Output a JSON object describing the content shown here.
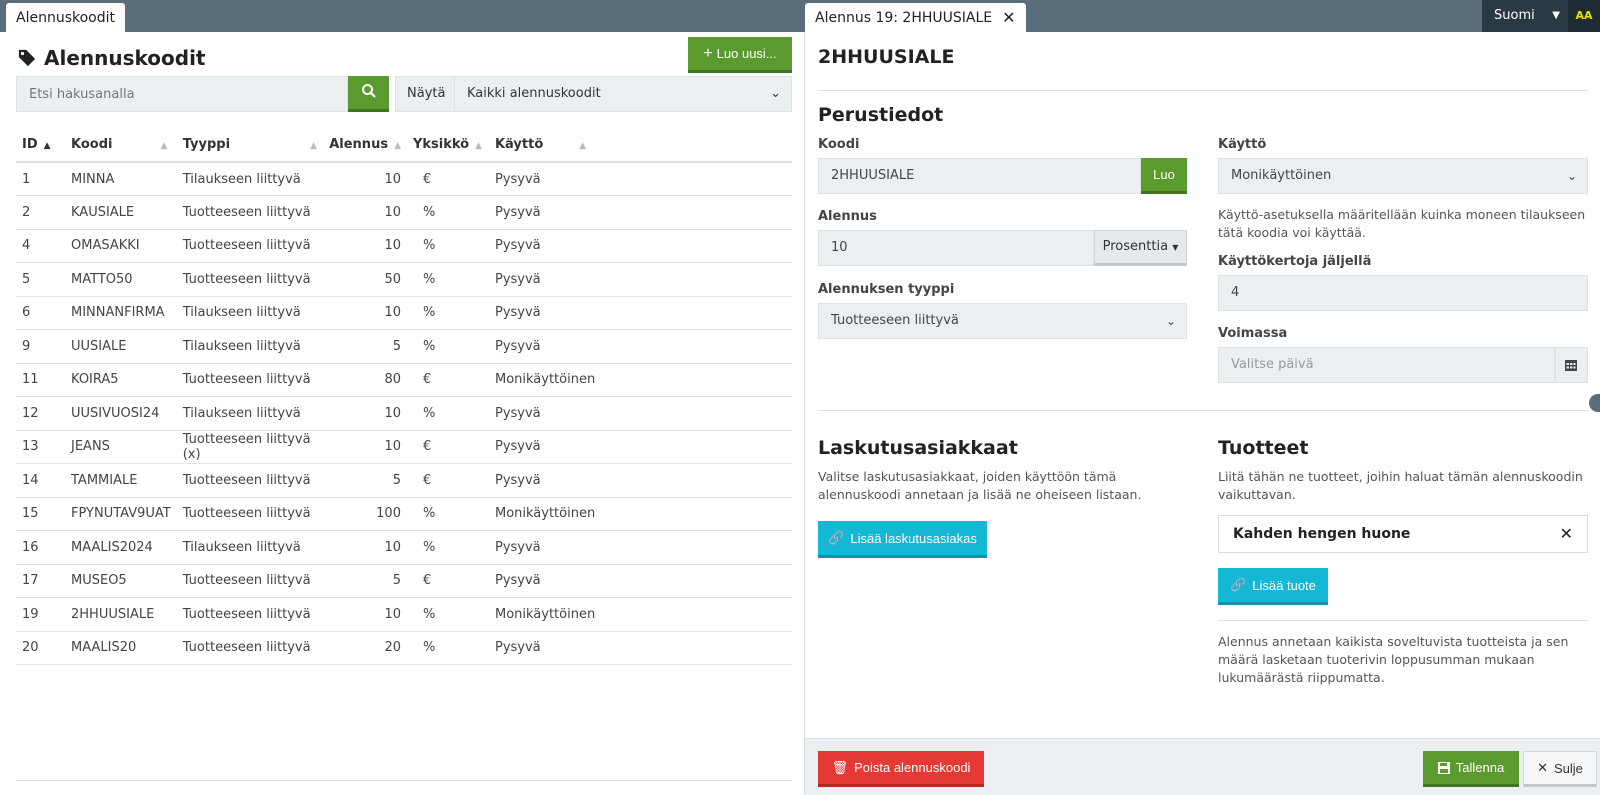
{
  "tabs": {
    "left_label": "Alennuskoodit",
    "right_label": "Alennus 19: 2HHUUSIALE"
  },
  "language": "Suomi",
  "accessibility_label": "AA",
  "list": {
    "title": "Alennuskoodit",
    "new_button": "Luo uusi...",
    "search_placeholder": "Etsi hakusanalla",
    "show_label": "Näytä",
    "show_value": "Kaikki alennuskoodit",
    "columns": [
      "ID",
      "Koodi",
      "Tyyppi",
      "Alennus",
      "Yksikkö",
      "Käyttö"
    ],
    "rows": [
      [
        "1",
        "MINNA",
        "Tilaukseen liittyvä",
        "10",
        "€",
        "Pysyvä"
      ],
      [
        "2",
        "KAUSIALE",
        "Tuotteeseen liittyvä",
        "10",
        "%",
        "Pysyvä"
      ],
      [
        "4",
        "OMASAKKI",
        "Tuotteeseen liittyvä",
        "10",
        "%",
        "Pysyvä"
      ],
      [
        "5",
        "MATTO50",
        "Tuotteeseen liittyvä",
        "50",
        "%",
        "Pysyvä"
      ],
      [
        "6",
        "MINNANFIRMA",
        "Tilaukseen liittyvä",
        "10",
        "%",
        "Pysyvä"
      ],
      [
        "9",
        "UUSIALE",
        "Tilaukseen liittyvä",
        "5",
        "%",
        "Pysyvä"
      ],
      [
        "11",
        "KOIRA5",
        "Tuotteeseen liittyvä",
        "80",
        "€",
        "Monikäyttöinen"
      ],
      [
        "12",
        "UUSIVUOSI24",
        "Tilaukseen liittyvä",
        "10",
        "%",
        "Pysyvä"
      ],
      [
        "13",
        "JEANS",
        "Tuotteeseen liittyvä (x)",
        "10",
        "€",
        "Pysyvä"
      ],
      [
        "14",
        "TAMMIALE",
        "Tuotteeseen liittyvä",
        "5",
        "€",
        "Pysyvä"
      ],
      [
        "15",
        "FPYNUTAV9UAT",
        "Tuotteeseen liittyvä",
        "100",
        "%",
        "Monikäyttöinen"
      ],
      [
        "16",
        "MAALIS2024",
        "Tilaukseen liittyvä",
        "10",
        "%",
        "Pysyvä"
      ],
      [
        "17",
        "MUSEO5",
        "Tuotteeseen liittyvä",
        "5",
        "€",
        "Pysyvä"
      ],
      [
        "19",
        "2HHUUSIALE",
        "Tuotteeseen liittyvä",
        "10",
        "%",
        "Monikäyttöinen"
      ],
      [
        "20",
        "MAALIS20",
        "Tuotteeseen liittyvä",
        "20",
        "%",
        "Pysyvä"
      ]
    ]
  },
  "detail": {
    "title": "2HHUUSIALE",
    "basic_title": "Perustiedot",
    "code_label": "Koodi",
    "code_value": "2HHUUSIALE",
    "generate_button": "Luo",
    "discount_label": "Alennus",
    "discount_value": "10",
    "unit_button": "Prosenttia",
    "type_label": "Alennuksen tyyppi",
    "type_value": "Tuotteeseen liittyvä",
    "usage_label": "Käyttö",
    "usage_value": "Monikäyttöinen",
    "usage_help": "Käyttö-asetuksella määritellään kuinka moneen tilaukseen tätä koodia voi käyttää.",
    "remaining_label": "Käyttökertoja jäljellä",
    "remaining_value": "4",
    "valid_label": "Voimassa",
    "valid_placeholder": "Valitse päivä",
    "customers_title": "Laskutusasiakkaat",
    "customers_help": "Valitse laskutusasiakkaat, joiden käyttöön tämä alennuskoodi annetaan ja lisää ne oheiseen listaan.",
    "add_customer_button": "Lisää laskutusasiakas",
    "products_title": "Tuotteet",
    "products_help": "Liitä tähän ne tuotteet, joihin haluat tämän alennuskoodin vaikuttavan.",
    "product_item": "Kahden hengen huone",
    "add_product_button": "Lisää tuote",
    "products_note": "Alennus annetaan kaikista soveltuvista tuotteista ja sen määrä lasketaan tuoterivin loppusumman mukaan lukumäärästä riippumatta.",
    "delete_button": "Poista alennuskoodi",
    "save_button": "Tallenna",
    "close_button": "Sulje"
  },
  "colors": {
    "topbar": "#5a6e7a",
    "green": "#5a9a2e",
    "cyan": "#14b8d4",
    "red": "#e53935"
  }
}
